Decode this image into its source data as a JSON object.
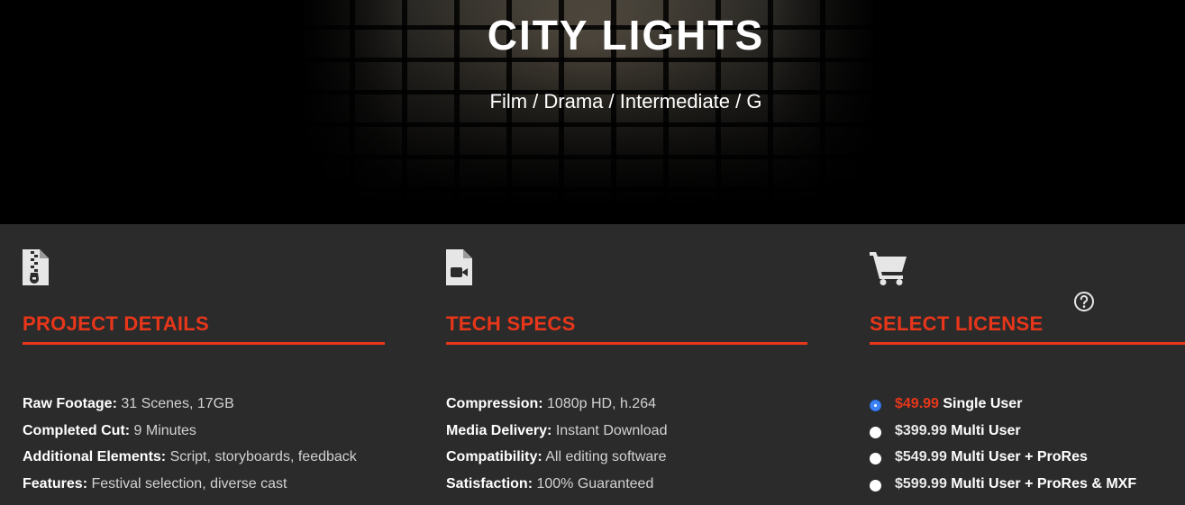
{
  "hero": {
    "title": "CITY LIGHTS",
    "subtitle": "Film / Drama / Intermediate / G"
  },
  "project": {
    "icon": "zip-file-icon",
    "title": "PROJECT DETAILS",
    "rows": [
      {
        "label": "Raw Footage:",
        "value": " 31 Scenes, 17GB"
      },
      {
        "label": "Completed Cut:",
        "value": " 9 Minutes"
      },
      {
        "label": "Additional Elements:",
        "value": " Script, storyboards, feedback"
      },
      {
        "label": "Features:",
        "value": " Festival selection, diverse cast"
      }
    ]
  },
  "tech": {
    "icon": "video-file-icon",
    "title": "TECH SPECS",
    "rows": [
      {
        "label": "Compression:",
        "value": " 1080p HD, h.264"
      },
      {
        "label": "Media Delivery:",
        "value": " Instant Download"
      },
      {
        "label": "Compatibility:",
        "value": " All editing software"
      },
      {
        "label": "Satisfaction:",
        "value": " 100% Guaranteed"
      }
    ]
  },
  "license": {
    "icon": "shopping-cart-icon",
    "help_icon": "question-circle-icon",
    "title": "SELECT LICENSE",
    "options": [
      {
        "price": "$49.99",
        "name": " Single User",
        "selected": true
      },
      {
        "price": "$399.99",
        "name": " Multi User",
        "selected": false
      },
      {
        "price": "$549.99",
        "name": " Multi User + ProRes",
        "selected": false
      },
      {
        "price": "$599.99",
        "name": " Multi User + ProRes & MXF",
        "selected": false
      }
    ]
  },
  "colors": {
    "accent": "#e8361a",
    "panel": "#2b2b2b",
    "radio_selected": "#3b82f6"
  }
}
